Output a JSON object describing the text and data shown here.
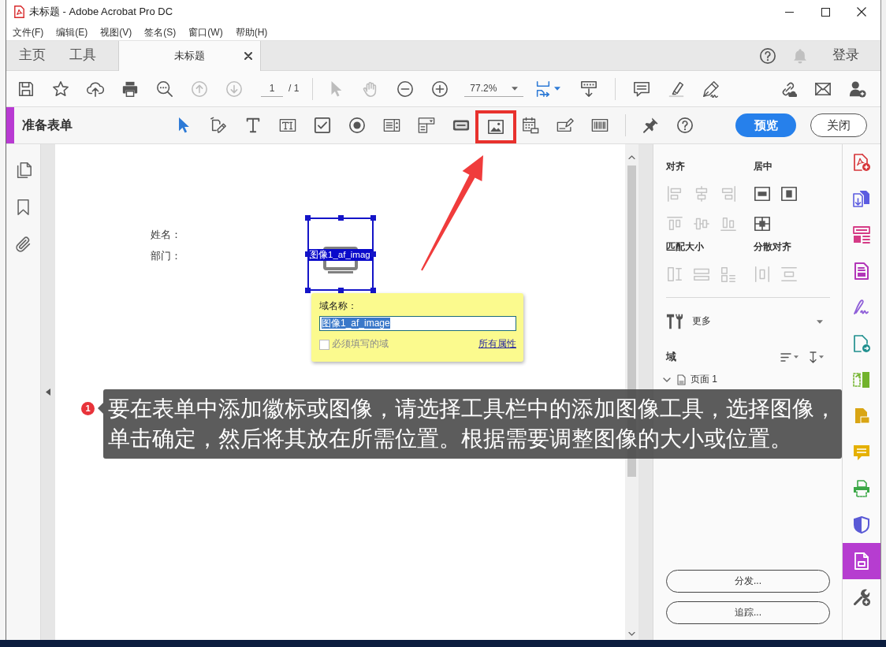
{
  "window": {
    "title": "未标题 - Adobe Acrobat Pro DC"
  },
  "menu": [
    "文件(F)",
    "编辑(E)",
    "视图(V)",
    "签名(S)",
    "窗口(W)",
    "帮助(H)"
  ],
  "tabs": [
    {
      "label": "主页",
      "kind": "home",
      "selected": false
    },
    {
      "label": "工具",
      "kind": "home",
      "selected": false
    },
    {
      "label": "未标题",
      "kind": "document",
      "selected": true
    }
  ],
  "account": {
    "sign_in": "登录"
  },
  "toolbar": {
    "page": "1",
    "page_count": "/ 1",
    "page_nav_disabled": true,
    "zoom": "77.2%"
  },
  "form_toolbar": {
    "title": "准备表单",
    "tools": [
      {
        "selected": true,
        "highlighted": false
      },
      {
        "selected": false,
        "highlighted": false
      },
      {
        "selected": false,
        "highlighted": false
      },
      {
        "selected": false,
        "highlighted": false
      },
      {
        "selected": false,
        "highlighted": false
      },
      {
        "selected": false,
        "highlighted": false
      },
      {
        "selected": false,
        "highlighted": false
      },
      {
        "selected": false,
        "highlighted": false
      },
      {
        "selected": false,
        "highlighted": false
      },
      {
        "selected": false,
        "highlighted": true
      },
      {
        "selected": false,
        "highlighted": false
      },
      {
        "selected": false,
        "highlighted": false
      },
      {
        "selected": false,
        "highlighted": false
      }
    ],
    "preview": "预览",
    "close": "关闭"
  },
  "document": {
    "labels": [
      "姓名：",
      "部门："
    ],
    "image_field": {
      "label": "图像1_af_imag",
      "selected": true
    },
    "popup": {
      "label": "域名称：",
      "value": "图像1_af_image",
      "value_selected": true,
      "required": {
        "label": "必须填写的域",
        "checked": false
      },
      "link": "所有属性"
    }
  },
  "right_panel": {
    "groups": [
      {
        "label": "对齐",
        "disabled": true
      },
      {
        "label": "居中",
        "disabled": false
      },
      {
        "label": "匹配大小",
        "disabled": true
      },
      {
        "label": "分散对齐",
        "disabled": true
      }
    ],
    "more": "更多",
    "fields_title": "域",
    "tree": [
      {
        "label": "页面 1",
        "expanded": true
      }
    ],
    "buttons": [
      "分发...",
      "追踪..."
    ]
  },
  "tool_rail": [
    {
      "color": "#d6363a",
      "selected": false
    },
    {
      "color": "#5c5ce0",
      "selected": false
    },
    {
      "color": "#d53b86",
      "selected": false
    },
    {
      "color": "#b236b8",
      "selected": false
    },
    {
      "color": "#8f5fd8",
      "selected": false
    },
    {
      "color": "#21908f",
      "selected": false
    },
    {
      "color": "#72b32b",
      "selected": false
    },
    {
      "color": "#d9a514",
      "selected": false
    },
    {
      "color": "#e5b000",
      "selected": false
    },
    {
      "color": "#3aa745",
      "selected": false
    },
    {
      "color": "#5a5ad6",
      "selected": false
    },
    {
      "color": "#b63dd0",
      "selected": true
    },
    {
      "color": "#555555",
      "selected": false
    }
  ],
  "annotation": {
    "number": "1",
    "text": "要在表单中添加徽标或图像，请选择工具栏中的添加图像工具，选择图像，单击确定，然后将其放在所需位置。根据需要调整图像的大小或位置。"
  }
}
